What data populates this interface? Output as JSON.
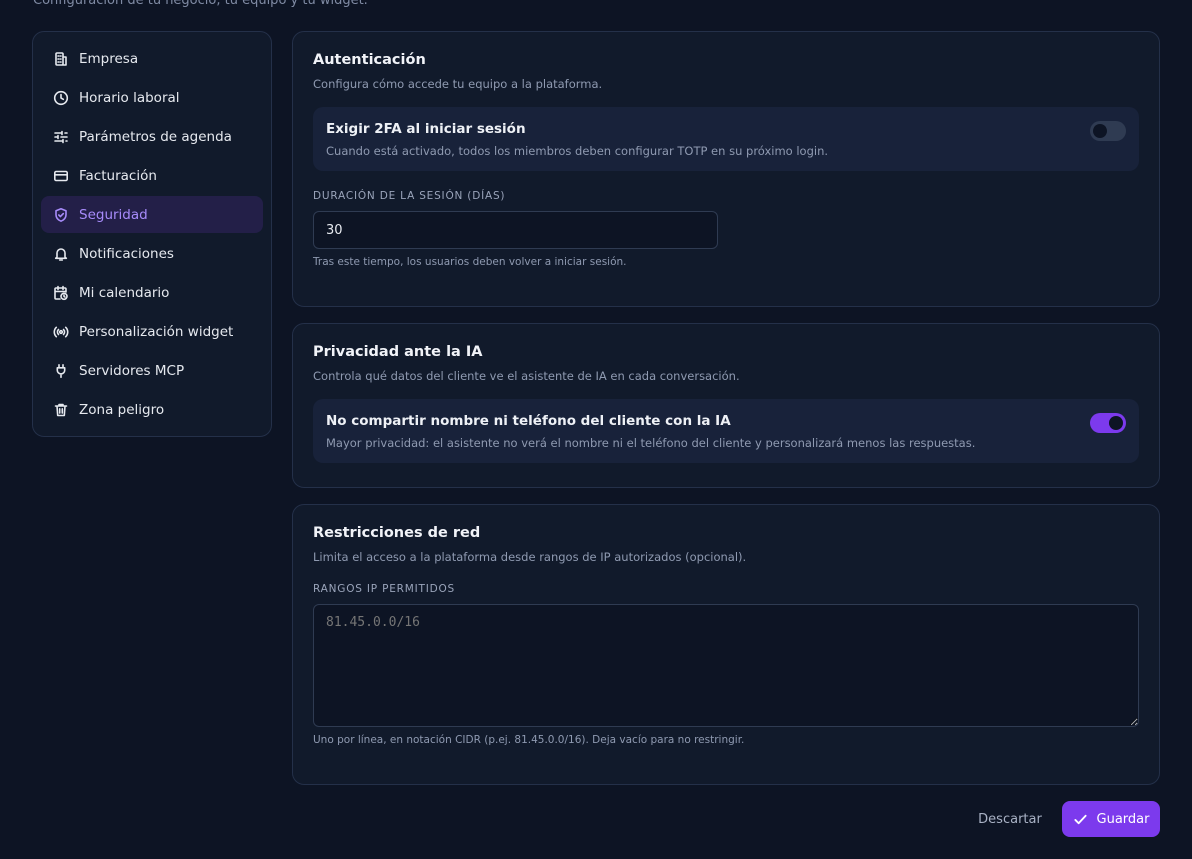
{
  "header": {
    "subtitle": "Configuración de tu negocio, tu equipo y tu widget."
  },
  "sidebar": {
    "items": [
      {
        "label": "Empresa",
        "icon": "building-icon"
      },
      {
        "label": "Horario laboral",
        "icon": "clock-icon"
      },
      {
        "label": "Parámetros de agenda",
        "icon": "sliders-icon"
      },
      {
        "label": "Facturación",
        "icon": "credit-card-icon"
      },
      {
        "label": "Seguridad",
        "icon": "shield-check-icon",
        "active": true
      },
      {
        "label": "Notificaciones",
        "icon": "bell-icon"
      },
      {
        "label": "Mi calendario",
        "icon": "calendar-clock-icon"
      },
      {
        "label": "Personalización widget",
        "icon": "broadcast-icon"
      },
      {
        "label": "Servidores MCP",
        "icon": "plug-icon"
      },
      {
        "label": "Zona peligro",
        "icon": "trash-icon"
      }
    ]
  },
  "auth": {
    "title": "Autenticación",
    "description": "Configura cómo accede tu equipo a la plataforma.",
    "twofa": {
      "title": "Exigir 2FA al iniciar sesión",
      "description": "Cuando está activado, todos los miembros deben configurar TOTP en su próximo login.",
      "enabled": false
    },
    "session": {
      "label": "Duración de la sesión (días)",
      "value": "30",
      "hint": "Tras este tiempo, los usuarios deben volver a iniciar sesión."
    }
  },
  "privacy": {
    "title": "Privacidad ante la IA",
    "description": "Controla qué datos del cliente ve el asistente de IA en cada conversación.",
    "toggle": {
      "title": "No compartir nombre ni teléfono del cliente con la IA",
      "description": "Mayor privacidad: el asistente no verá el nombre ni el teléfono del cliente y personalizará menos las respuestas.",
      "enabled": true
    }
  },
  "network": {
    "title": "Restricciones de red",
    "description": "Limita el acceso a la plataforma desde rangos de IP autorizados (opcional).",
    "ranges": {
      "label": "Rangos IP permitidos",
      "placeholder": "81.45.0.0/16",
      "hint": "Uno por línea, en notación CIDR (p.ej. 81.45.0.0/16). Deja vacío para no restringir."
    }
  },
  "actions": {
    "discard": "Descartar",
    "save": "Guardar"
  },
  "colors": {
    "accent": "#7c3aed",
    "active_text": "#a78bfa",
    "background": "#0d1424",
    "card": "#111a2b"
  }
}
